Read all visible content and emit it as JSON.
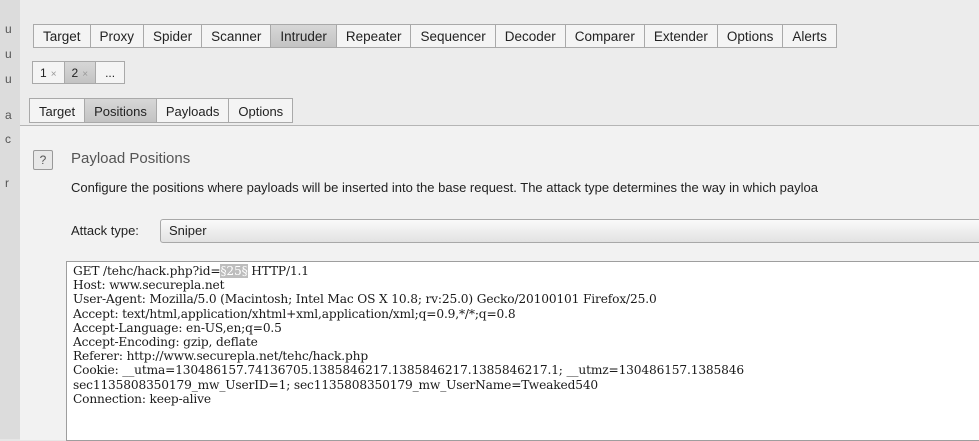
{
  "left_strip": [
    "u",
    "u",
    "u",
    "a",
    "c",
    "r"
  ],
  "main_tabs": [
    "Target",
    "Proxy",
    "Spider",
    "Scanner",
    "Intruder",
    "Repeater",
    "Sequencer",
    "Decoder",
    "Comparer",
    "Extender",
    "Options",
    "Alerts"
  ],
  "main_selected": "Intruder",
  "sub_tabs": [
    {
      "label": "1",
      "close": "×"
    },
    {
      "label": "2",
      "close": "×"
    },
    {
      "label": "..."
    }
  ],
  "section_tabs": [
    "Target",
    "Positions",
    "Payloads",
    "Options"
  ],
  "section_selected": "Positions",
  "panel": {
    "help": "?",
    "title": "Payload Positions",
    "description": "Configure the positions where payloads will be inserted into the base request. The attack type determines the way in which payloa",
    "attack_label": "Attack type:",
    "attack_value": "Sniper"
  },
  "request": {
    "line1_before": "GET /tehc/hack.php?id=",
    "line1_marker": "§25§",
    "line1_after": " HTTP/1.1",
    "lines": [
      "Host: www.securepla.net",
      "User-Agent: Mozilla/5.0 (Macintosh; Intel Mac OS X 10.8; rv:25.0) Gecko/20100101 Firefox/25.0",
      "Accept: text/html,application/xhtml+xml,application/xml;q=0.9,*/*;q=0.8",
      "Accept-Language: en-US,en;q=0.5",
      "Accept-Encoding: gzip, deflate",
      "Referer: http://www.securepla.net/tehc/hack.php",
      "Cookie: __utma=130486157.74136705.1385846217.1385846217.1385846217.1; __utmz=130486157.1385846",
      "sec1135808350179_mw_UserID=1; sec1135808350179_mw_UserName=Tweaked540",
      "Connection: keep-alive"
    ]
  }
}
